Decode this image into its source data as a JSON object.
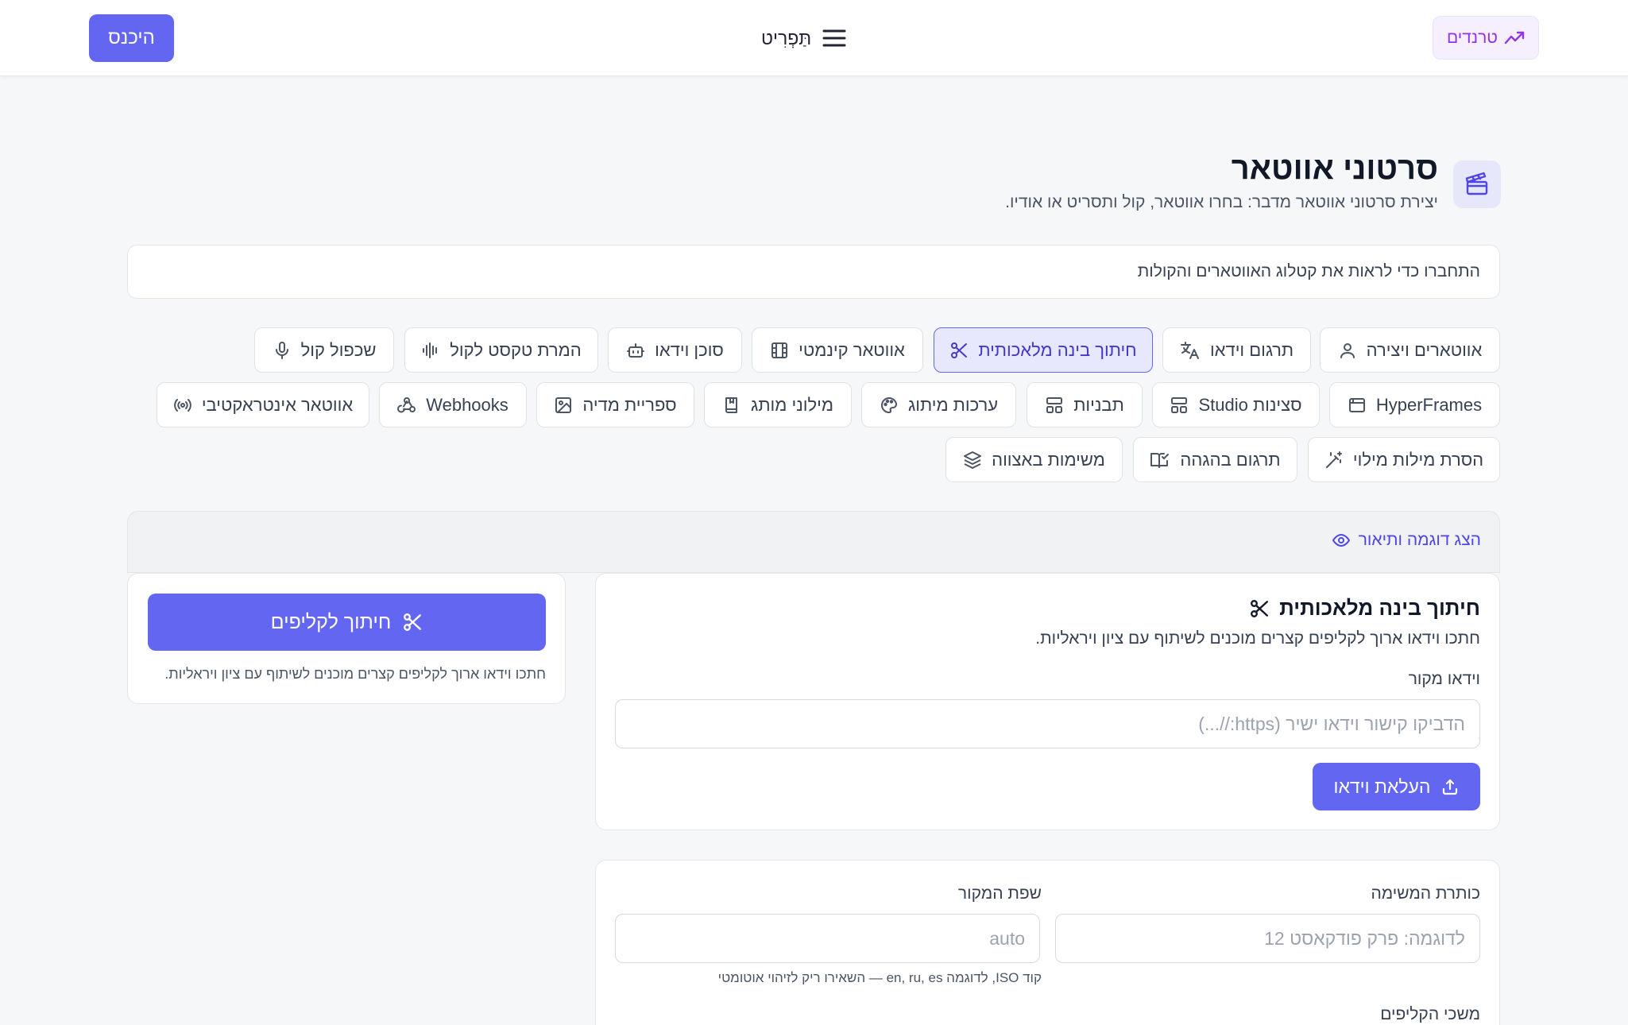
{
  "header": {
    "login_label": "היכנס",
    "menu_label": "תַּפְרִיט",
    "trends_label": "טרנדים"
  },
  "page": {
    "title": "סרטוני אווטאר",
    "subtitle": "יצירת סרטוני אווטאר מדבר: בחרו אווטאר, קול ותסריט או אודיו.",
    "connect_notice": "התחברו כדי לראות את קטלוג האווטארים והקולות"
  },
  "tabs": {
    "avatars": "אווטארים ויצירה",
    "translate": "תרגום וידאו",
    "ai_cut": "חיתוך בינה מלאכותית",
    "cinematic": "אווטאר קינמטי",
    "video_agent": "סוכן וידאו",
    "tts": "המרת טקסט לקול",
    "dub": "שכפול קול",
    "hyperframes": "HyperFrames",
    "studio": "סצינות Studio",
    "templates": "תבניות",
    "brand_kits": "ערכות מיתוג",
    "brand_glossary": "מילוני מותג",
    "media_library": "ספריית מדיה",
    "webhooks": "Webhooks",
    "interactive": "אווטאר אינטראקטיבי",
    "filler_removal": "הסרת מילות מילוי",
    "proofread_translation": "תרגום בהגהה",
    "batch_tasks": "משימות באצווה"
  },
  "preview": {
    "link_label": "הצג דוגמה ותיאור"
  },
  "cut_card": {
    "title": "חיתוך בינה מלאכותית",
    "description": "חתכו וידאו ארוך לקליפים קצרים מוכנים לשיתוף עם ציון ויראליות.",
    "source_label": "וידאו מקור",
    "source_placeholder": "הדביקו קישור וידאו ישיר (https://...)",
    "upload_label": "העלאת וידאו"
  },
  "side_card": {
    "button_label": "חיתוך לקליפים",
    "description": "חתכו וידאו ארוך לקליפים קצרים מוכנים לשיתוף עם ציון ויראליות."
  },
  "form_card": {
    "task_title_label": "כותרת המשימה",
    "task_title_placeholder": "לדוגמה: פרק פודקאסט 12",
    "source_lang_label": "שפת המקור",
    "source_lang_placeholder": "auto",
    "source_lang_hint": "קוד ISO, לדוגמה en, ru, es — השאירו ריק לזיהוי אוטומטי",
    "clip_length_label": "משכי הקליפים"
  },
  "colors": {
    "accent": "#6366f1",
    "accent_soft": "#e7e8fd",
    "trends": "#9333ea",
    "page_bg": "#f6f7f9"
  },
  "icons": {
    "menu": "hamburger-icon",
    "trends": "trend-up-icon",
    "page": "clapperboard-icon"
  }
}
